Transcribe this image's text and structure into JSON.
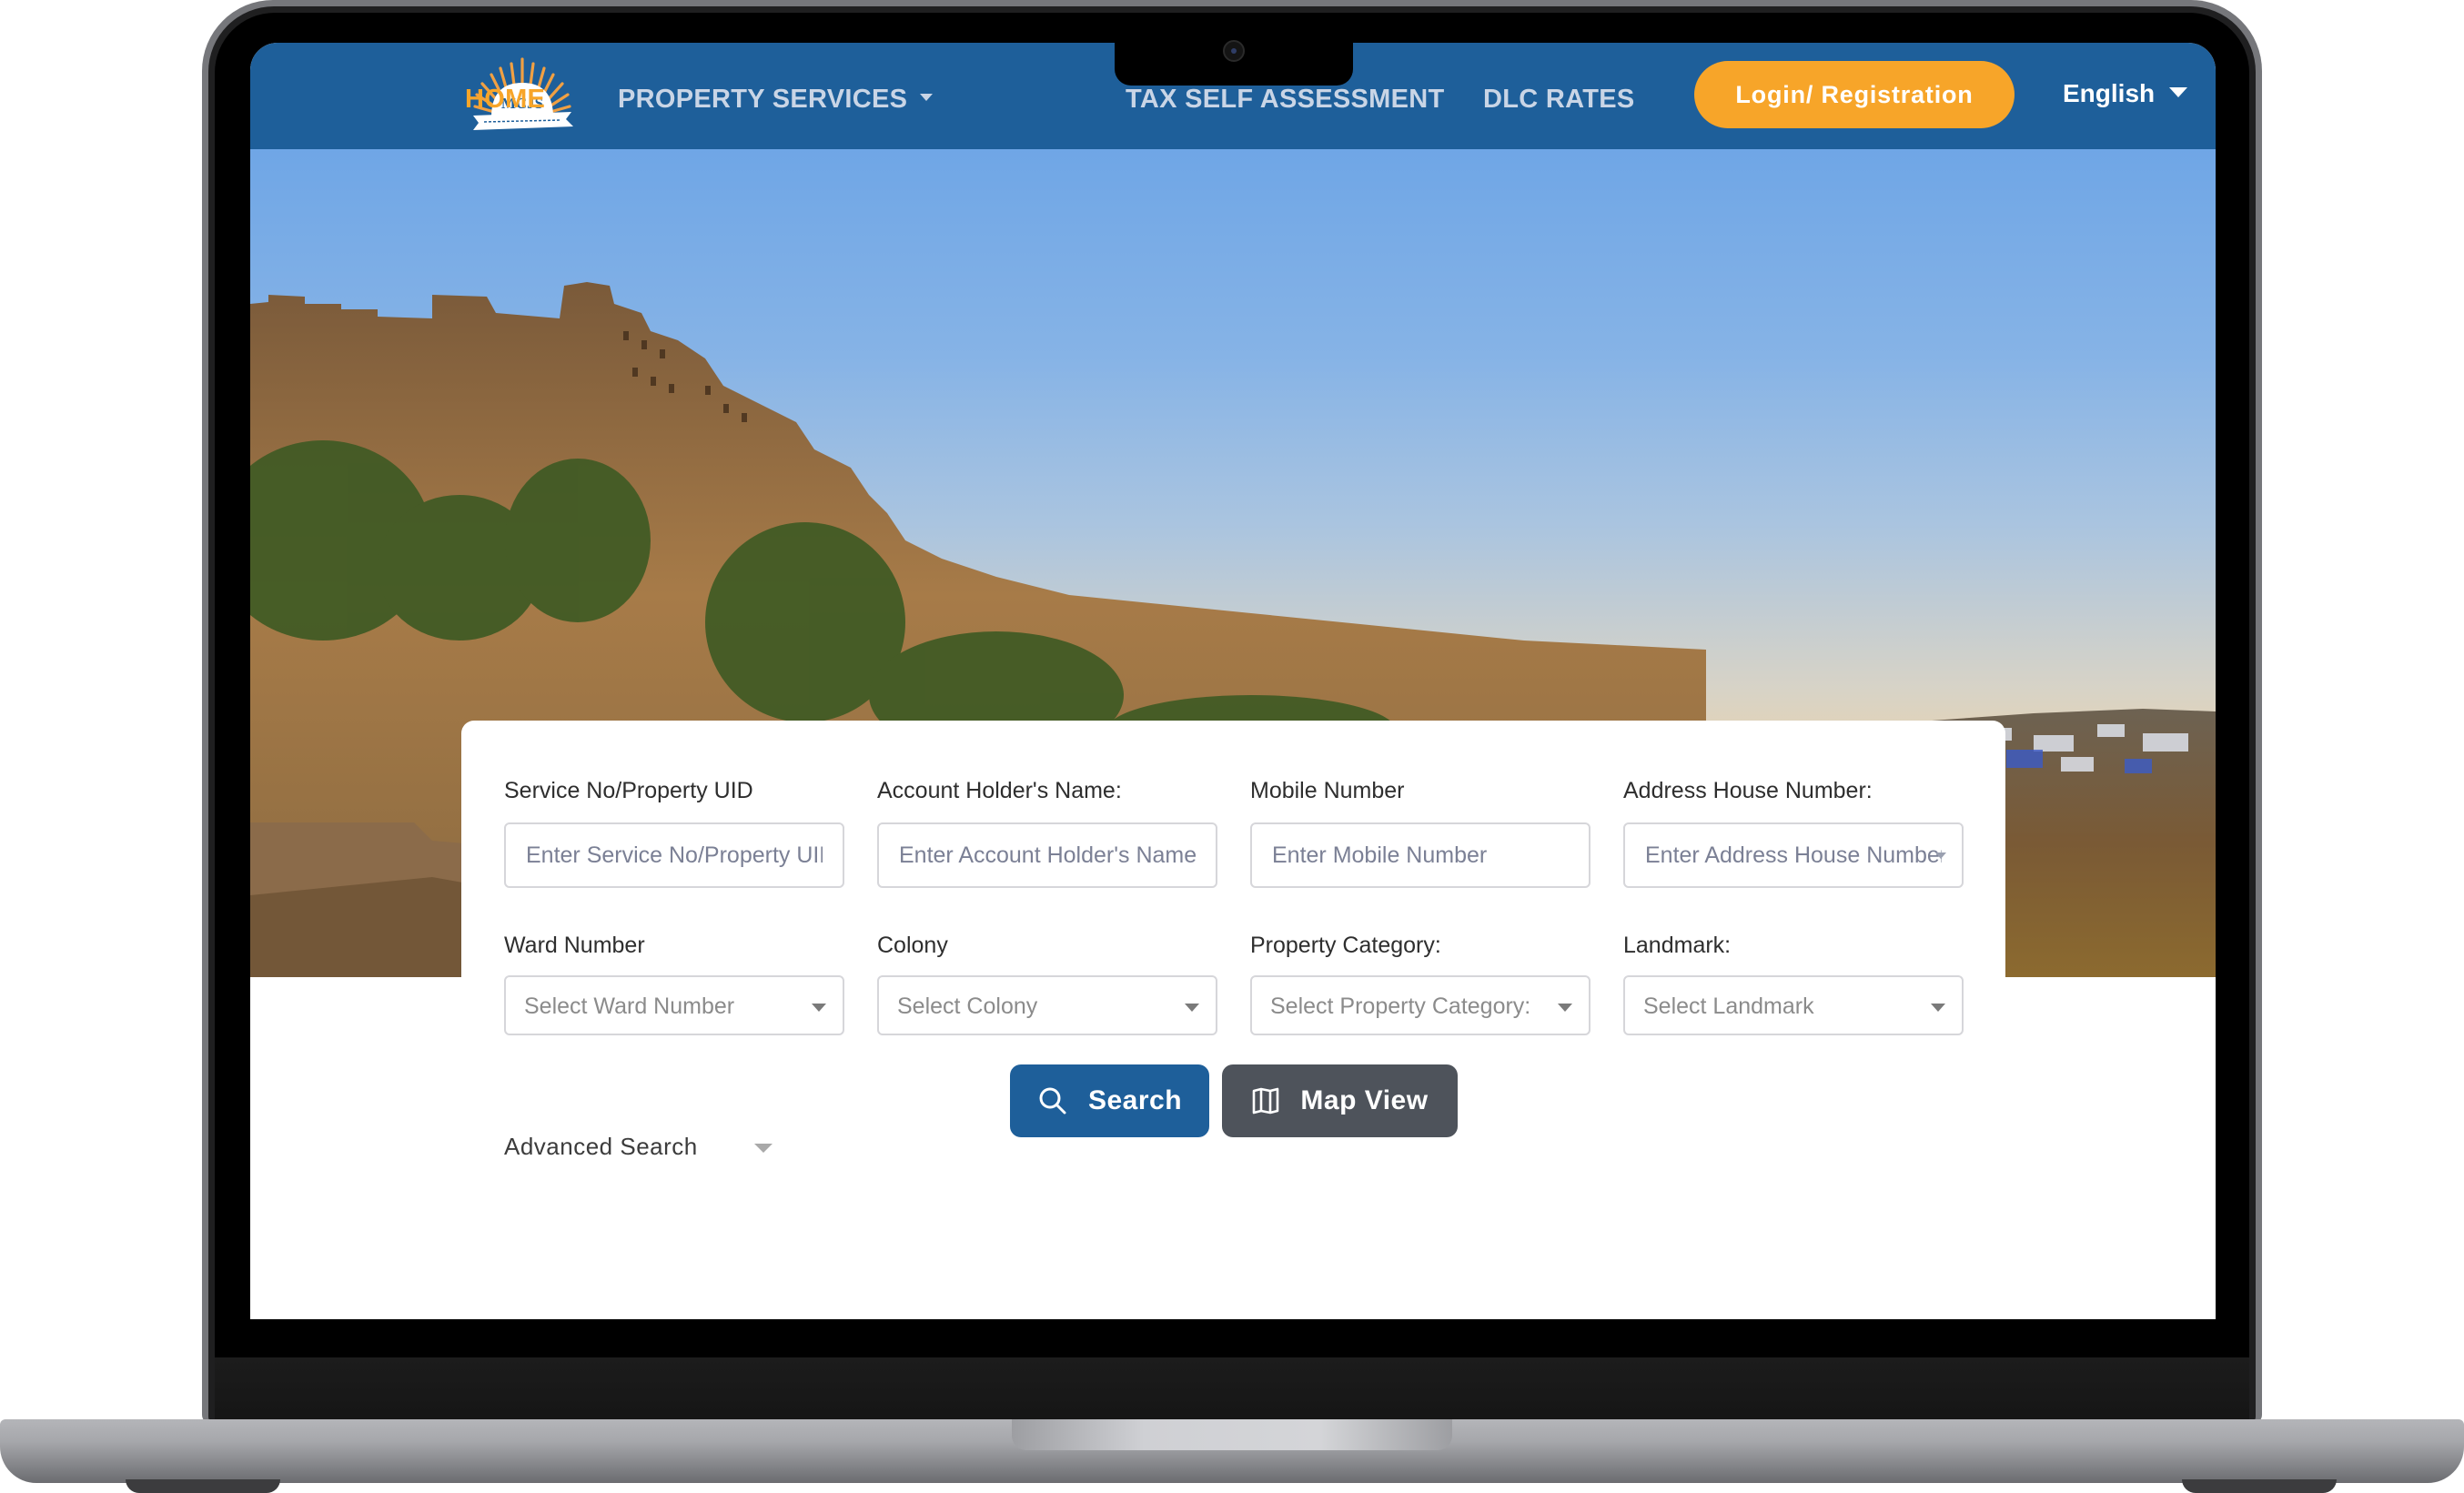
{
  "nav": {
    "logo_text": "MCJS",
    "items": [
      {
        "label": "HOME",
        "active": true
      },
      {
        "label": "PROPERTY SERVICES",
        "has_dropdown": true
      },
      {
        "label": "TAX SELF ASSESSMENT"
      },
      {
        "label": "DLC RATES"
      }
    ],
    "login_label": "Login/ Registration",
    "language": "English"
  },
  "colors": {
    "primary": "#1e5f9a",
    "accent": "#f7a529",
    "secondary_button": "#4e535b"
  },
  "search_form": {
    "fields": [
      {
        "label": "Service No/Property UID",
        "placeholder": "Enter Service No/Property UID",
        "type": "text"
      },
      {
        "label": "Account Holder's Name:",
        "placeholder": "Enter Account Holder's Name",
        "type": "text"
      },
      {
        "label": "Mobile Number",
        "placeholder": "Enter Mobile Number",
        "type": "text"
      },
      {
        "label": "Address House Number:",
        "placeholder": "Enter Address House Number",
        "type": "text"
      }
    ],
    "selects": [
      {
        "label": "Ward Number",
        "value": "Select Ward Number"
      },
      {
        "label": "Colony",
        "value": "Select Colony"
      },
      {
        "label": "Property Category:",
        "value": "Select Property Category:"
      },
      {
        "label": "Landmark:",
        "value": "Select Landmark"
      }
    ],
    "advanced_search_label": "Advanced Search",
    "search_button": "Search",
    "map_view_button": "Map View"
  }
}
